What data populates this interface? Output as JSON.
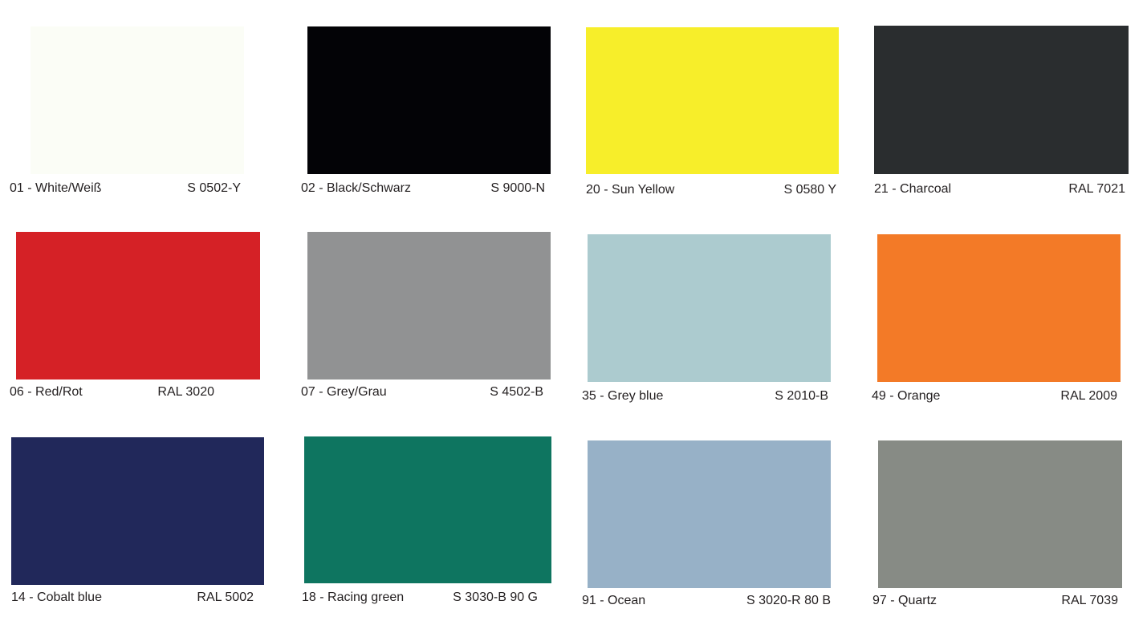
{
  "swatches": [
    {
      "name": "01 -  White/Weiß",
      "code": "S 0502-Y",
      "color": "#fbfdf6"
    },
    {
      "name": "02 - Black/Schwarz",
      "code": "S 9000-N",
      "color": "#030306"
    },
    {
      "name": "20 - Sun Yellow",
      "code": "S 0580 Y",
      "color": "#f7ee2a"
    },
    {
      "name": "21 - Charcoal",
      "code": "RAL 7021",
      "color": "#2a2d2f"
    },
    {
      "name": "06 - Red/Rot",
      "code": "RAL 3020",
      "color": "#d52126"
    },
    {
      "name": "07 - Grey/Grau",
      "code": "S 4502-B",
      "color": "#919293"
    },
    {
      "name": "35 - Grey blue",
      "code": "S 2010-B",
      "color": "#accbcf"
    },
    {
      "name": "49 - Orange",
      "code": "RAL 2009",
      "color": "#f37a27"
    },
    {
      "name": "14 - Cobalt blue",
      "code": "RAL 5002",
      "color": "#21285a"
    },
    {
      "name": "18 - Racing green",
      "code": "S 3030-B 90 G",
      "color": "#0e7560"
    },
    {
      "name": "91 - Ocean",
      "code": "S 3020-R 80 B",
      "color": "#97b1c7"
    },
    {
      "name": "97 - Quartz",
      "code": "RAL 7039",
      "color": "#878b85"
    }
  ]
}
